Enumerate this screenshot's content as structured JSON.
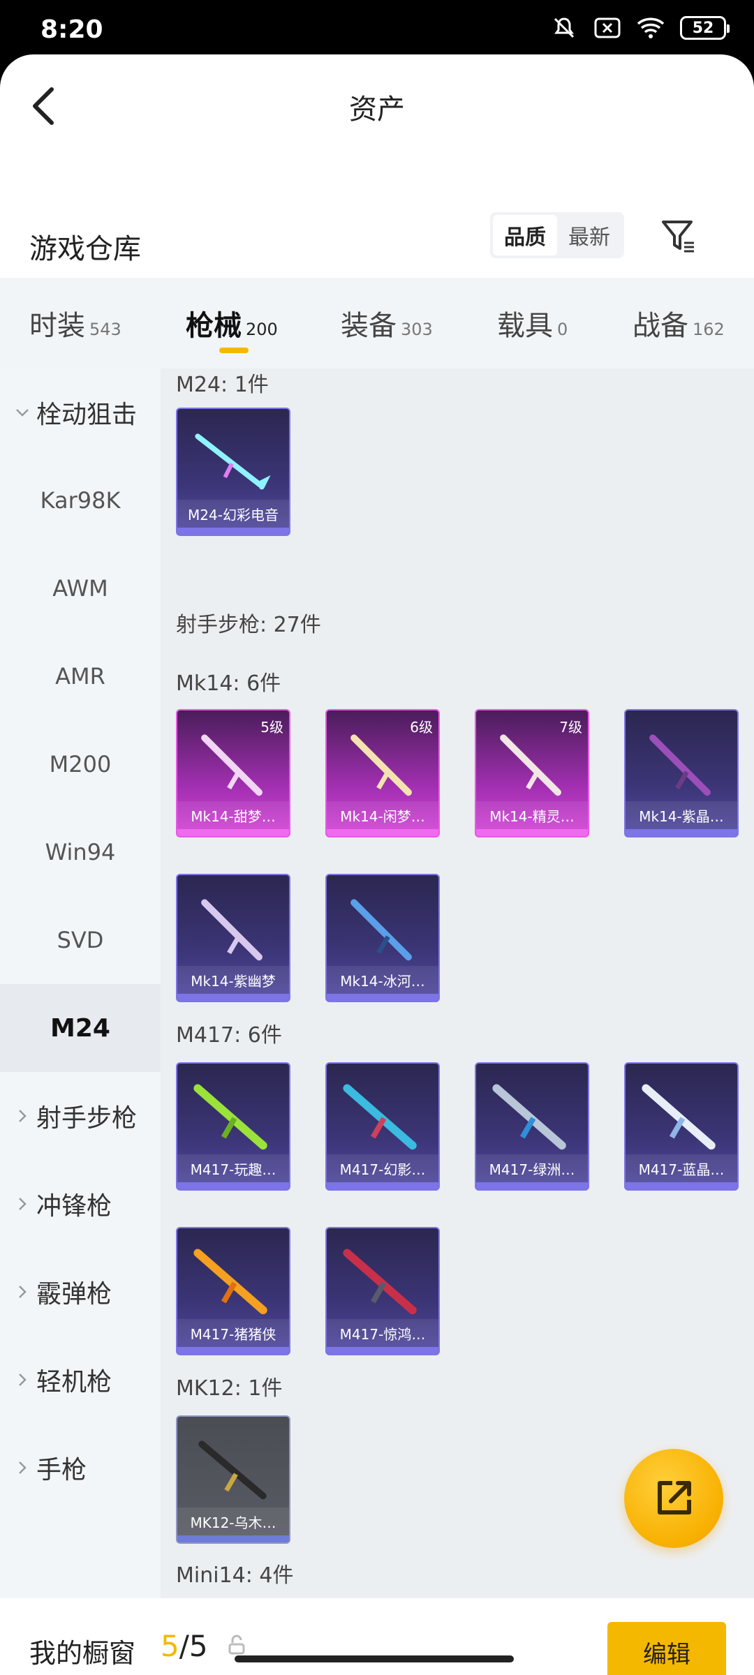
{
  "status_bar": {
    "time": "8:20",
    "battery": "52"
  },
  "nav": {
    "title": "资产"
  },
  "section": {
    "title": "游戏仓库",
    "sort_options": [
      "品质",
      "最新"
    ]
  },
  "tabs": [
    {
      "label": "时装",
      "count": "543"
    },
    {
      "label": "枪械",
      "count": "200"
    },
    {
      "label": "装备",
      "count": "303"
    },
    {
      "label": "载具",
      "count": "0"
    },
    {
      "label": "战备",
      "count": "162"
    }
  ],
  "sidebar": {
    "group_bolt": "栓动狙击",
    "items": [
      "Kar98K",
      "AWM",
      "AMR",
      "M200",
      "Win94",
      "SVD",
      "M24"
    ],
    "groups": [
      "射手步枪",
      "冲锋枪",
      "霰弹枪",
      "轻机枪",
      "手枪"
    ]
  },
  "content": {
    "m24_label": "M24: 1件",
    "m24_items": [
      "M24-幻彩电音"
    ],
    "dmr_label": "射手步枪: 27件",
    "mk14_label": "Mk14: 6件",
    "mk14_items": [
      {
        "name": "Mk14-甜梦…",
        "level": "5级"
      },
      {
        "name": "Mk14-闲梦…",
        "level": "6级"
      },
      {
        "name": "Mk14-精灵…",
        "level": "7级"
      },
      {
        "name": "Mk14-紫晶…",
        "level": ""
      },
      {
        "name": "Mk14-紫幽梦",
        "level": ""
      },
      {
        "name": "Mk14-冰河…",
        "level": ""
      }
    ],
    "m417_label": "M417: 6件",
    "m417_items": [
      "M417-玩趣…",
      "M417-幻影…",
      "M417-绿洲…",
      "M417-蓝晶…",
      "M417-猪猪侠",
      "M417-惊鸿…"
    ],
    "mk12_label": "MK12: 1件",
    "mk12_items": [
      "MK12-乌木…"
    ],
    "mini14_label": "Mini14: 4件"
  },
  "bottom": {
    "label": "我的橱窗",
    "current": "5",
    "total": "/5",
    "edit": "编辑"
  },
  "colors": {
    "accent": "#f5b800",
    "quality_purple": "#7d74e8",
    "quality_pink": "#e858e8"
  }
}
